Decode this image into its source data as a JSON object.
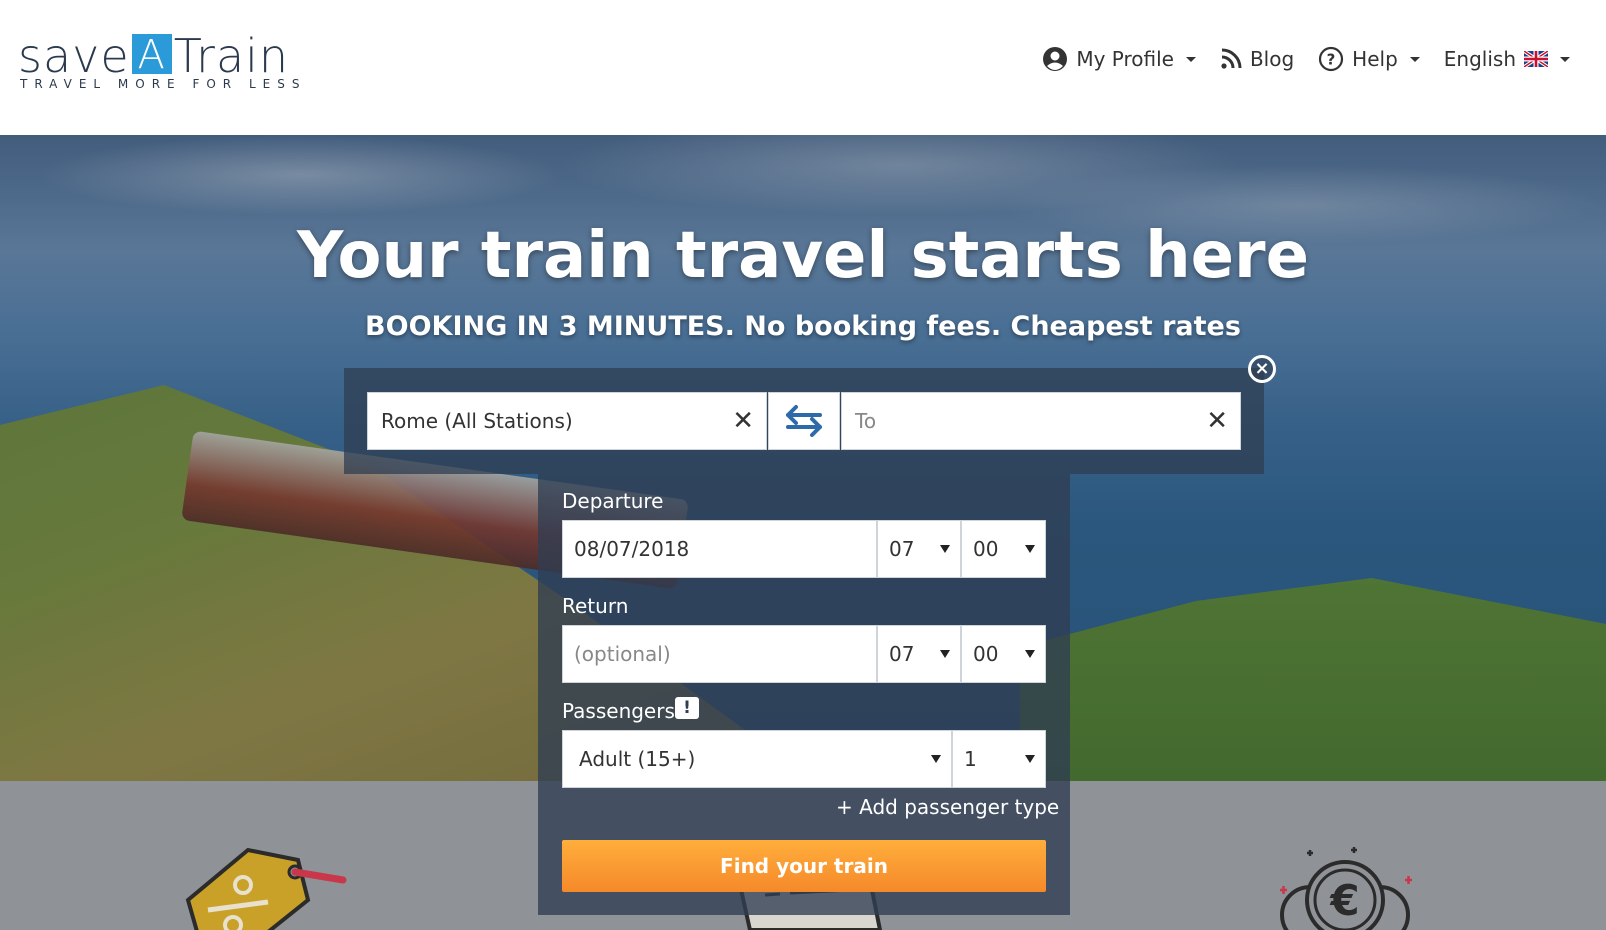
{
  "brand": {
    "logo_prefix": "save",
    "logo_a": "A",
    "logo_suffix": "Train",
    "tagline": "TRAVEL MORE FOR LESS",
    "accent_color": "#2b9ad8"
  },
  "nav": {
    "profile_label": "My Profile",
    "profile_icon": "user-circle-icon",
    "blog_label": "Blog",
    "blog_icon": "rss-icon",
    "help_label": "Help",
    "help_icon": "question-circle-icon",
    "language_label": "English",
    "language_icon": "uk-flag-icon"
  },
  "hero": {
    "title": "Your train travel starts here",
    "subtitle": "BOOKING IN 3 MINUTES. No booking fees. Cheapest rates"
  },
  "search": {
    "from_value": "Rome (All Stations)",
    "to_placeholder": "To",
    "departure_label": "Departure",
    "departure_date": "08/07/2018",
    "departure_hour": "07",
    "departure_minute": "00",
    "return_label": "Return",
    "return_placeholder": "(optional)",
    "return_hour": "07",
    "return_minute": "00",
    "passengers_label": "Passengers",
    "passenger_type": "Adult (15+)",
    "passenger_count": "1",
    "add_passenger_label": "+ Add passenger type",
    "submit_label": "Find your train",
    "submit_color": "#f7942e"
  }
}
